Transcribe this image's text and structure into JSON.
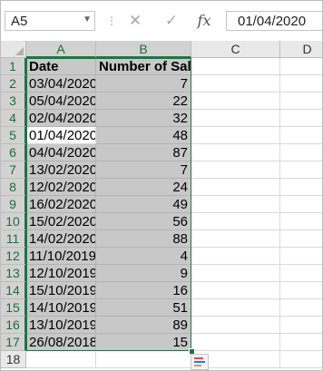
{
  "formula_bar": {
    "name_box": "A5",
    "formula_value": "01/04/2020",
    "cancel_glyph": "✕",
    "enter_glyph": "✓",
    "fx_glyph": "fx"
  },
  "columns": [
    "A",
    "B",
    "C",
    "D"
  ],
  "rows": [
    {
      "num": "1",
      "date": "Date",
      "sales": "Number of Sales"
    },
    {
      "num": "2",
      "date": "03/04/2020",
      "sales": "7"
    },
    {
      "num": "3",
      "date": "05/04/2020",
      "sales": "22"
    },
    {
      "num": "4",
      "date": "02/04/2020",
      "sales": "32"
    },
    {
      "num": "5",
      "date": "01/04/2020",
      "sales": "48"
    },
    {
      "num": "6",
      "date": "04/04/2020",
      "sales": "87"
    },
    {
      "num": "7",
      "date": "13/02/2020",
      "sales": "7"
    },
    {
      "num": "8",
      "date": "12/02/2020",
      "sales": "24"
    },
    {
      "num": "9",
      "date": "16/02/2020",
      "sales": "49"
    },
    {
      "num": "10",
      "date": "15/02/2020",
      "sales": "56"
    },
    {
      "num": "11",
      "date": "14/02/2020",
      "sales": "88"
    },
    {
      "num": "12",
      "date": "11/10/2019",
      "sales": "4"
    },
    {
      "num": "13",
      "date": "12/10/2019",
      "sales": "9"
    },
    {
      "num": "14",
      "date": "15/10/2019",
      "sales": "16"
    },
    {
      "num": "15",
      "date": "14/10/2019",
      "sales": "51"
    },
    {
      "num": "16",
      "date": "13/10/2019",
      "sales": "89"
    },
    {
      "num": "17",
      "date": "26/08/2018",
      "sales": "15"
    },
    {
      "num": "18",
      "date": "",
      "sales": ""
    }
  ],
  "active_cell": "A5",
  "selection": "A1:B17",
  "colors": {
    "selection_border": "#217346",
    "selection_fill": "#c8c8c8",
    "header_fill": "#e9e9e9"
  },
  "icons": {
    "quick_analysis": "quick-analysis-icon",
    "name_box_dropdown": "chevron-down-icon"
  }
}
